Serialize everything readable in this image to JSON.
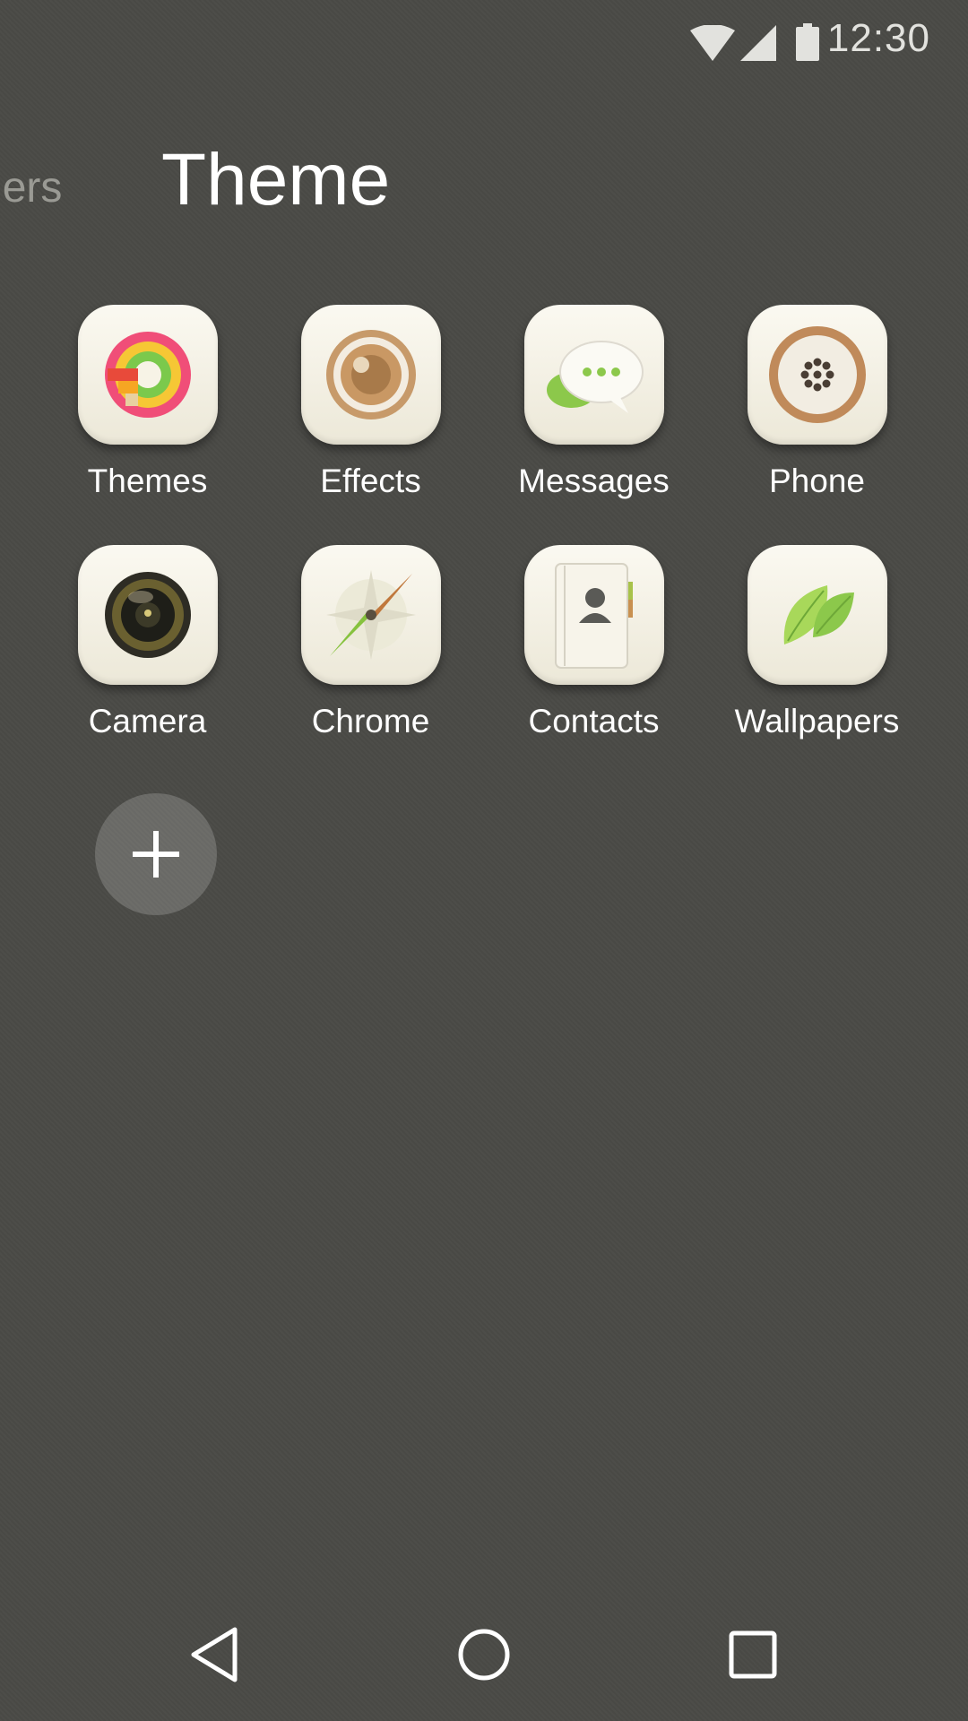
{
  "status_bar": {
    "time": "12:30",
    "icons": [
      "wifi-icon",
      "cell-signal-icon",
      "battery-icon"
    ]
  },
  "header": {
    "prev_tab_label": "hers",
    "current_tab_label": "Theme"
  },
  "apps": [
    {
      "label": "Themes",
      "icon": "themes-icon"
    },
    {
      "label": "Effects",
      "icon": "effects-icon"
    },
    {
      "label": "Messages",
      "icon": "messages-icon"
    },
    {
      "label": "Phone",
      "icon": "phone-icon"
    },
    {
      "label": "Camera",
      "icon": "camera-icon"
    },
    {
      "label": "Chrome",
      "icon": "compass-icon"
    },
    {
      "label": "Contacts",
      "icon": "contacts-icon"
    },
    {
      "label": "Wallpapers",
      "icon": "leaf-icon"
    }
  ],
  "add_button": {
    "icon": "plus-icon"
  },
  "nav_bar": {
    "icons": [
      "back-icon",
      "home-icon",
      "recents-icon"
    ]
  },
  "colors": {
    "background": "#4a4a46",
    "icon_tile": "#f4f1e6",
    "accent_brown": "#b88a5c",
    "accent_green": "#8cc84b"
  }
}
